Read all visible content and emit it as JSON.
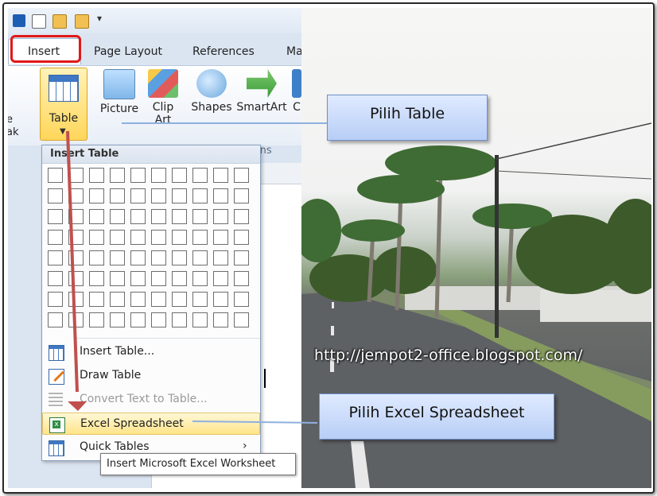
{
  "ribbon": {
    "tabs": [
      "Insert",
      "Page Layout",
      "References",
      "Ma"
    ],
    "buttons": [
      {
        "label": "Table"
      },
      {
        "label": "Picture"
      },
      {
        "label": "Clip",
        "label2": "Art"
      },
      {
        "label": "Shapes"
      },
      {
        "label": "SmartArt"
      },
      {
        "label": "C"
      }
    ],
    "left_partial_labels": [
      "e",
      "ak"
    ],
    "group_label": "tions"
  },
  "dropdown": {
    "header": "Insert Table",
    "grid": {
      "cols": 10,
      "rows": 8
    },
    "items": [
      {
        "label": "Insert Table...",
        "icon": "insert-table-icon",
        "disabled": false
      },
      {
        "label": "Draw Table",
        "icon": "draw-table-icon",
        "disabled": false
      },
      {
        "label": "Convert Text to Table...",
        "icon": "convert-text-icon",
        "disabled": true
      },
      {
        "label": "Excel Spreadsheet",
        "icon": "excel-icon",
        "disabled": false,
        "highlighted": true
      },
      {
        "label": "Quick Tables",
        "icon": "quick-tables-icon",
        "disabled": false,
        "submenu": "›"
      }
    ]
  },
  "tooltip": "Insert Microsoft Excel Worksheet",
  "callouts": {
    "table": "Pilih Table",
    "excel": "Pilih Excel Spreadsheet"
  },
  "watermark": "http://jempot2-office.blogspot.com/",
  "colors": {
    "highlight_border": "#e01818",
    "arrow": "#c0504d",
    "callout_fill": "#c9dbfa"
  }
}
